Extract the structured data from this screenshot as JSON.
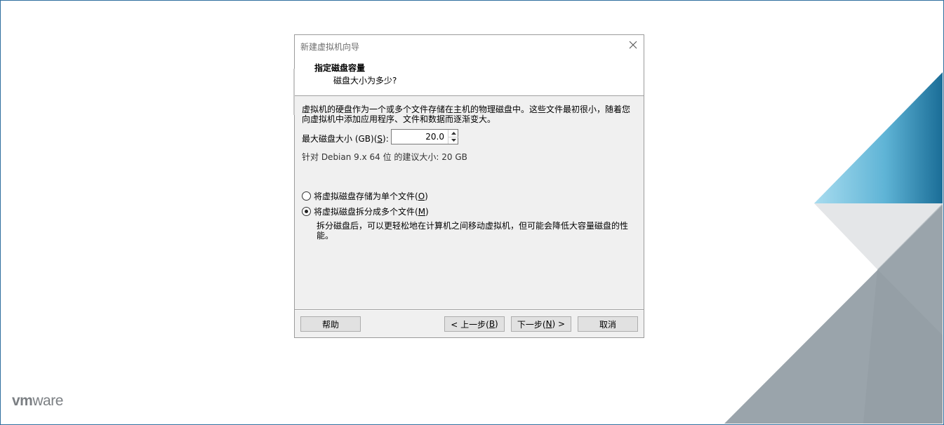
{
  "app": {
    "logo_text_bold": "vm",
    "logo_text_rest": "ware"
  },
  "dialog": {
    "title": "新建虚拟机向导",
    "heading": "指定磁盘容量",
    "subheading": "磁盘大小为多少?",
    "description": "虚拟机的硬盘作为一个或多个文件存储在主机的物理磁盘中。这些文件最初很小，随着您向虚拟机中添加应用程序、文件和数据而逐渐变大。",
    "max_size": {
      "label_prefix": "最大磁盘大小 (GB)(",
      "mnemonic": "S",
      "label_suffix": "):",
      "value": "20.0"
    },
    "recommendation": "针对 Debian 9.x 64 位 的建议大小: 20 GB",
    "options": [
      {
        "prefix": "将虚拟磁盘存储为单个文件(",
        "mnemonic": "O",
        "suffix": ")",
        "checked": false
      },
      {
        "prefix": "将虚拟磁盘拆分成多个文件(",
        "mnemonic": "M",
        "suffix": ")",
        "checked": true
      }
    ],
    "split_note": "拆分磁盘后，可以更轻松地在计算机之间移动虚拟机，但可能会降低大容量磁盘的性能。",
    "buttons": {
      "help": "帮助",
      "back_prefix": "< 上一步(",
      "back_mnemonic": "B",
      "back_suffix": ")",
      "next_prefix": "下一步(",
      "next_mnemonic": "N",
      "next_suffix": ") >",
      "cancel": "取消"
    }
  },
  "icons": {
    "close": "close-icon",
    "spin_up": "chevron-up-icon",
    "spin_down": "chevron-down-icon"
  },
  "colors": {
    "frame_border": "#2f6f9e",
    "dialog_bg": "#f0f0f0",
    "accent_blue_light": "#87cbe6",
    "accent_blue_dark": "#1e6f98",
    "gray_shape": "#9aa4ab"
  }
}
